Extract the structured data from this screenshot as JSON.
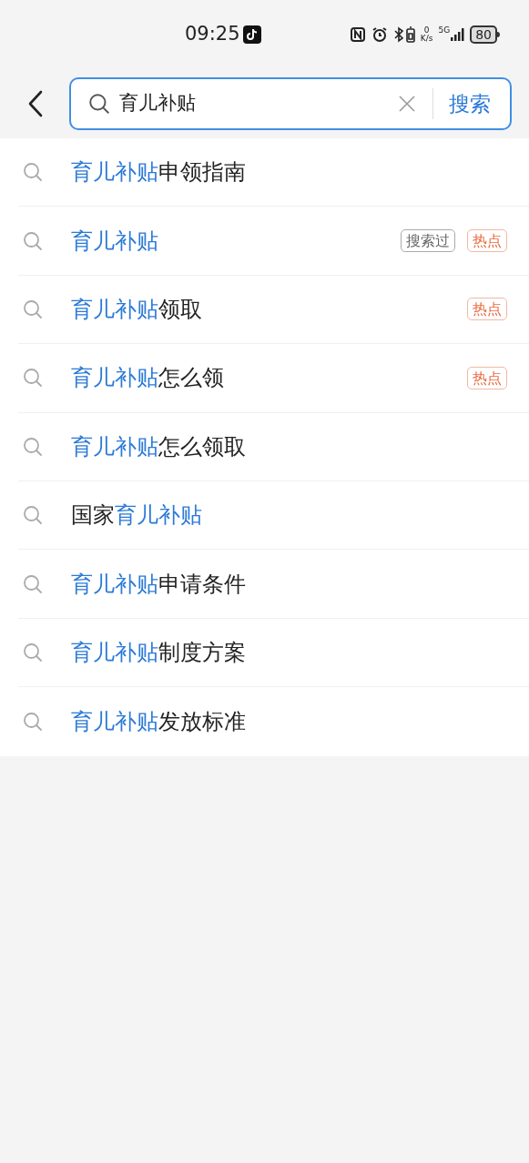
{
  "status_bar": {
    "time": "09:25",
    "net_speed_value": "0",
    "net_speed_unit": "K/s",
    "network": "5G",
    "battery": "80"
  },
  "search": {
    "value": "育儿补贴",
    "button": "搜索"
  },
  "suggestions": [
    {
      "parts": [
        {
          "text": "育儿补贴",
          "highlight": true
        },
        {
          "text": "申领指南",
          "highlight": false
        }
      ]
    },
    {
      "parts": [
        {
          "text": "育儿补贴",
          "highlight": true
        }
      ],
      "tags": [
        {
          "kind": "history",
          "text": "搜索过"
        },
        {
          "kind": "hot",
          "text": "热点"
        }
      ]
    },
    {
      "parts": [
        {
          "text": "育儿补贴",
          "highlight": true
        },
        {
          "text": "领取",
          "highlight": false
        }
      ],
      "tags": [
        {
          "kind": "hot",
          "text": "热点"
        }
      ]
    },
    {
      "parts": [
        {
          "text": "育儿补贴",
          "highlight": true
        },
        {
          "text": "怎么领",
          "highlight": false
        }
      ],
      "tags": [
        {
          "kind": "hot",
          "text": "热点"
        }
      ]
    },
    {
      "parts": [
        {
          "text": "育儿补贴",
          "highlight": true
        },
        {
          "text": "怎么领取",
          "highlight": false
        }
      ]
    },
    {
      "parts": [
        {
          "text": "国家",
          "highlight": false
        },
        {
          "text": "育儿补贴",
          "highlight": true
        }
      ]
    },
    {
      "parts": [
        {
          "text": "育儿补贴",
          "highlight": true
        },
        {
          "text": "申请条件",
          "highlight": false
        }
      ]
    },
    {
      "parts": [
        {
          "text": "育儿补贴",
          "highlight": true
        },
        {
          "text": "制度方案",
          "highlight": false
        }
      ]
    },
    {
      "parts": [
        {
          "text": "育儿补贴",
          "highlight": true
        },
        {
          "text": "发放标准",
          "highlight": false
        }
      ]
    }
  ]
}
